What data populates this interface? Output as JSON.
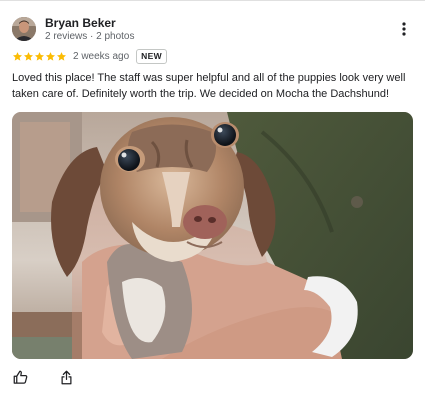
{
  "reviewer": {
    "name": "Bryan Beker",
    "meta": "2 reviews · 2 photos"
  },
  "review": {
    "rating": 5,
    "max_rating": 5,
    "date": "2 weeks ago",
    "badge": "NEW",
    "text": "Loved this place! The staff was super helpful and all of the puppies look very well taken care of. Definitely worth the trip. We decided on Mocha the Dachshund!"
  },
  "icons": {
    "star": "star-icon",
    "more": "more-vert-icon",
    "like": "thumbs-up-icon",
    "share": "share-icon"
  },
  "colors": {
    "star": "#fbbc04",
    "text": "#202124",
    "secondary_text": "#5f6368"
  }
}
